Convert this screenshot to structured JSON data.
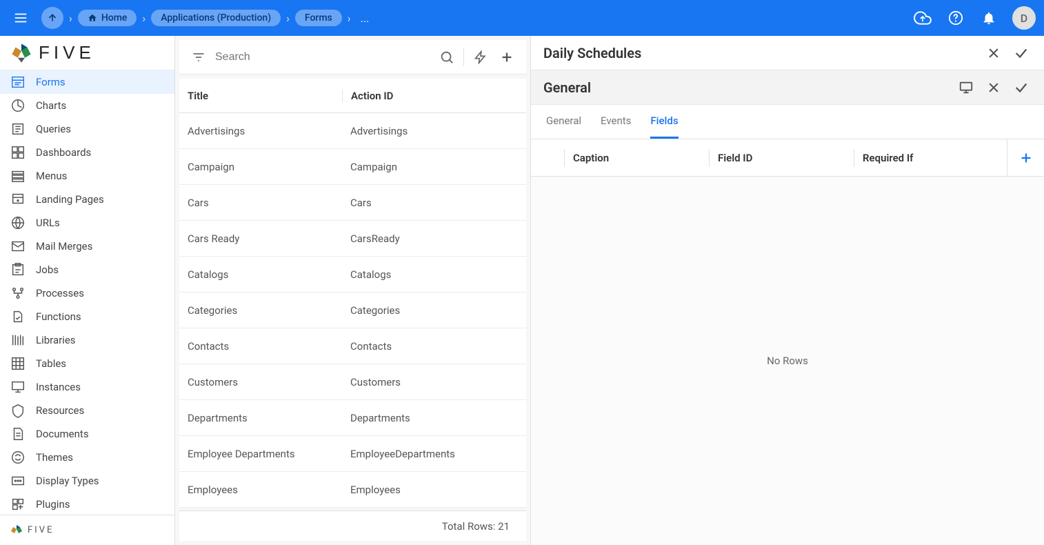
{
  "topbar": {
    "breadcrumbs": [
      {
        "label": "Home",
        "icon": "home"
      },
      {
        "label": "Applications (Production)"
      },
      {
        "label": "Forms"
      }
    ],
    "more": "...",
    "avatar_letter": "D"
  },
  "brand": "FIVE",
  "sidebar": {
    "items": [
      {
        "label": "Forms",
        "active": true
      },
      {
        "label": "Charts"
      },
      {
        "label": "Queries"
      },
      {
        "label": "Dashboards"
      },
      {
        "label": "Menus"
      },
      {
        "label": "Landing Pages"
      },
      {
        "label": "URLs"
      },
      {
        "label": "Mail Merges"
      },
      {
        "label": "Jobs"
      },
      {
        "label": "Processes"
      },
      {
        "label": "Functions"
      },
      {
        "label": "Libraries"
      },
      {
        "label": "Tables"
      },
      {
        "label": "Instances"
      },
      {
        "label": "Resources"
      },
      {
        "label": "Documents"
      },
      {
        "label": "Themes"
      },
      {
        "label": "Display Types"
      },
      {
        "label": "Plugins"
      }
    ],
    "footer_brand": "FIVE"
  },
  "list": {
    "search_placeholder": "Search",
    "columns": {
      "title": "Title",
      "action_id": "Action ID"
    },
    "rows": [
      {
        "title": "Advertisings",
        "action_id": "Advertisings"
      },
      {
        "title": "Campaign",
        "action_id": "Campaign"
      },
      {
        "title": "Cars",
        "action_id": "Cars"
      },
      {
        "title": "Cars Ready",
        "action_id": "CarsReady"
      },
      {
        "title": "Catalogs",
        "action_id": "Catalogs"
      },
      {
        "title": "Categories",
        "action_id": "Categories"
      },
      {
        "title": "Contacts",
        "action_id": "Contacts"
      },
      {
        "title": "Customers",
        "action_id": "Customers"
      },
      {
        "title": "Departments",
        "action_id": "Departments"
      },
      {
        "title": "Employee Departments",
        "action_id": "EmployeeDepartments"
      },
      {
        "title": "Employees",
        "action_id": "Employees"
      }
    ],
    "total_label": "Total Rows: 21"
  },
  "detail": {
    "title": "Daily Schedules",
    "section_title": "General",
    "tabs": [
      {
        "label": "General"
      },
      {
        "label": "Events"
      },
      {
        "label": "Fields",
        "active": true
      }
    ],
    "fields_columns": {
      "caption": "Caption",
      "field_id": "Field ID",
      "required_if": "Required If"
    },
    "empty": "No Rows"
  }
}
